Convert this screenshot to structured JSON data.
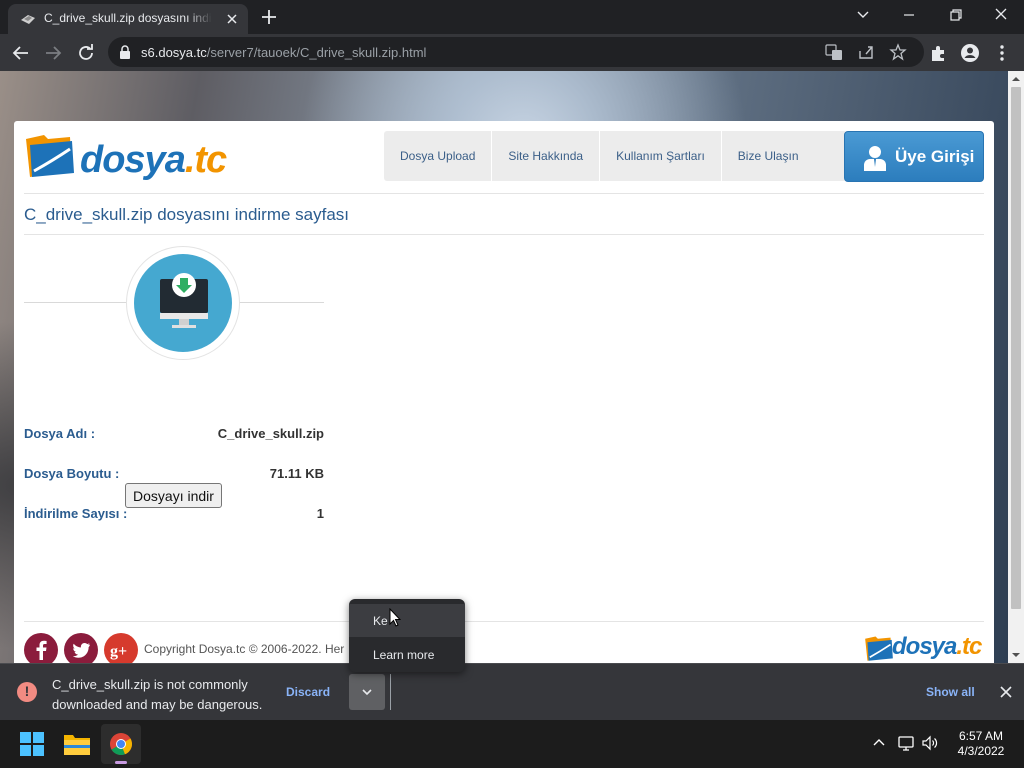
{
  "browser": {
    "tab_title": "C_drive_skull.zip dosyasını indir -",
    "url_host": "s6.dosya.tc",
    "url_path": "/server7/tauoek/C_drive_skull.zip.html"
  },
  "site": {
    "logo_part1": "dosya",
    "logo_part2": ".tc",
    "nav": [
      "Dosya Upload",
      "Site Hakkında",
      "Kullanım Şartları",
      "Bize Ulaşın"
    ],
    "login_label": "Üye Girişi",
    "page_title": "C_drive_skull.zip dosyasını indirme sayfası",
    "file_info": [
      {
        "label": "Dosya Adı :",
        "value": "C_drive_skull.zip"
      },
      {
        "label": "Dosya Boyutu :",
        "value": "71.11 KB"
      },
      {
        "label": "İndirilme Sayısı :",
        "value": "1"
      }
    ],
    "download_button": "Dosyayı indir",
    "copyright": "Copyright Dosya.tc © 2006-2022. Her",
    "social_icons": [
      "facebook-icon",
      "twitter-icon",
      "google-plus-icon"
    ],
    "colors": {
      "brand_blue": "#1d72b8",
      "brand_orange": "#f29400",
      "circle": "#45a8d0",
      "social": "#8b1c3c"
    }
  },
  "context_menu": {
    "items": [
      "Keep",
      "Learn more"
    ],
    "visible_first_item": "Ke"
  },
  "download_bar": {
    "warning_line1": "C_drive_skull.zip is not commonly",
    "warning_line2": "downloaded and may be dangerous.",
    "discard_label": "Discard",
    "show_all_label": "Show all"
  },
  "taskbar": {
    "time": "6:57 AM",
    "date": "4/3/2022"
  }
}
